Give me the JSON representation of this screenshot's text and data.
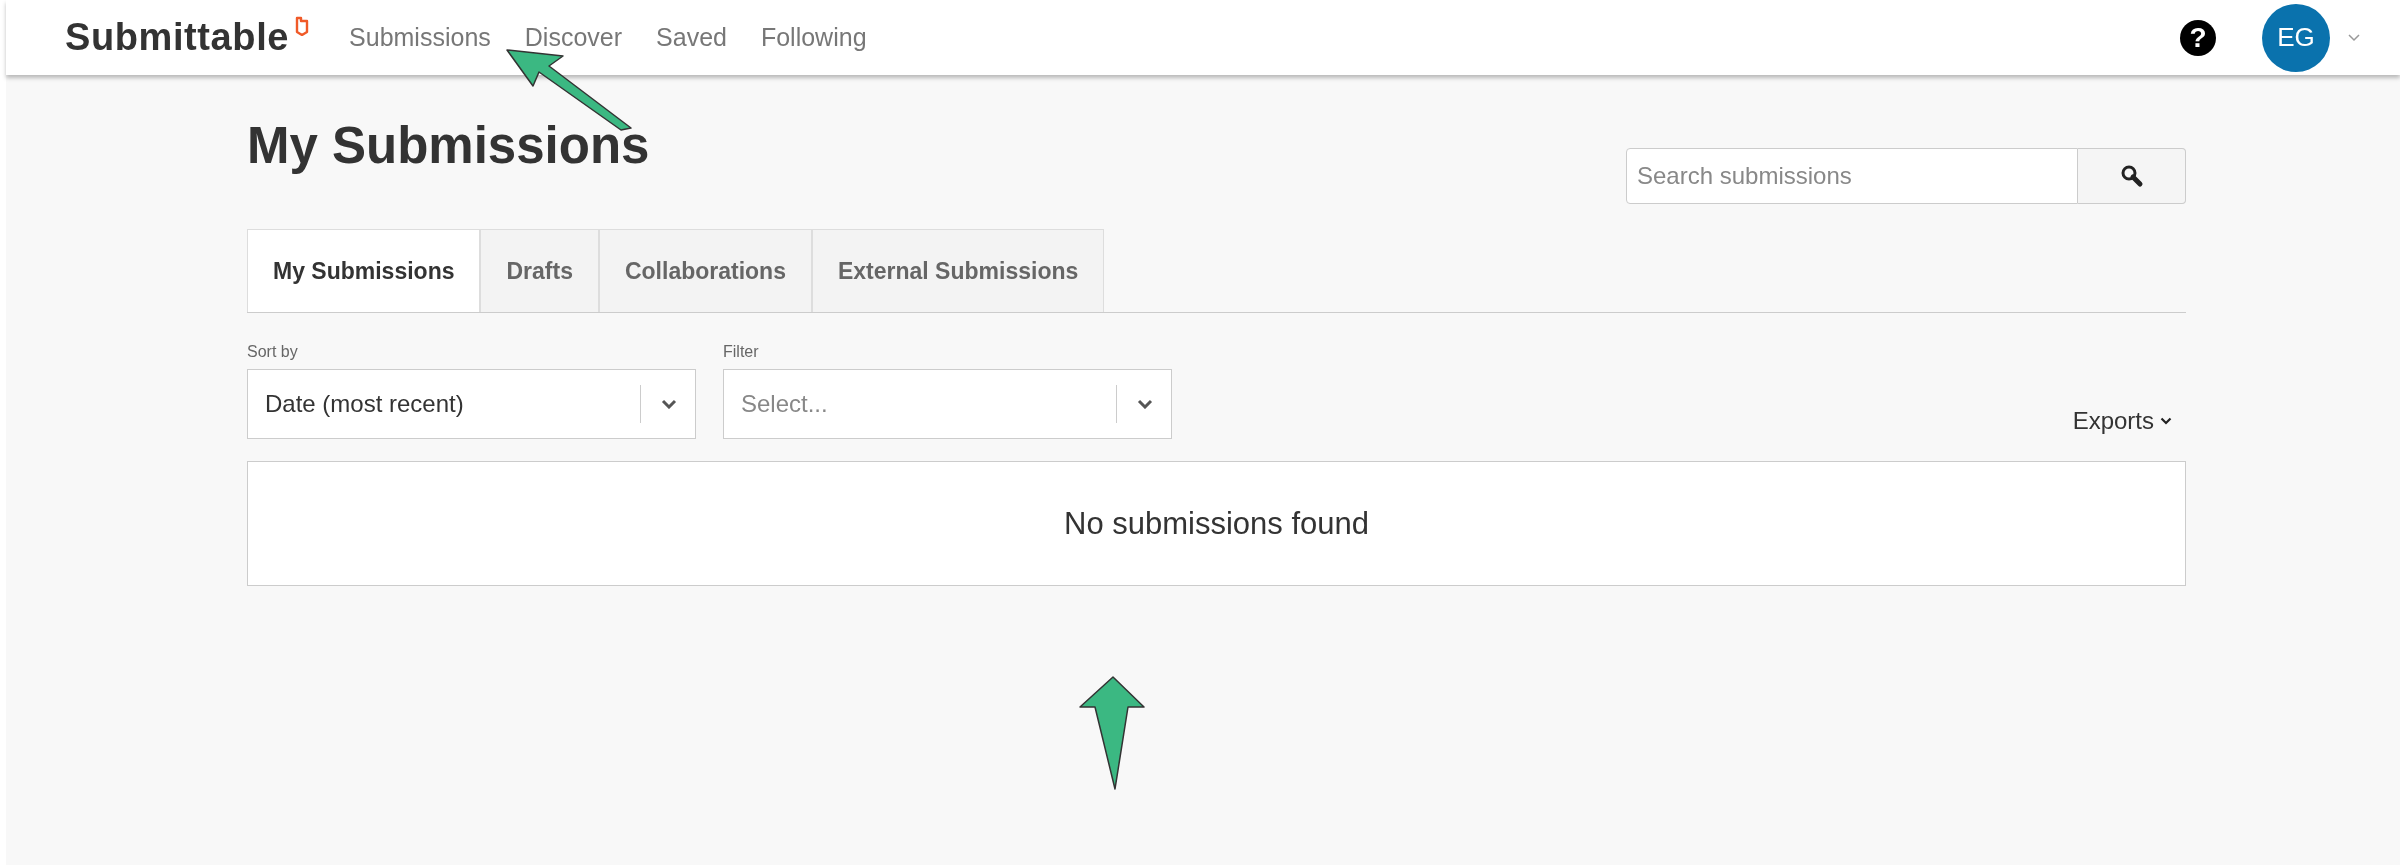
{
  "header": {
    "logo": "Submittable",
    "nav": [
      {
        "label": "Submissions"
      },
      {
        "label": "Discover"
      },
      {
        "label": "Saved"
      },
      {
        "label": "Following"
      }
    ],
    "help": "?",
    "avatar": "EG"
  },
  "page": {
    "title": "My Submissions",
    "search": {
      "placeholder": "Search submissions"
    },
    "tabs": [
      {
        "label": "My Submissions",
        "selected": true
      },
      {
        "label": "Drafts",
        "selected": false
      },
      {
        "label": "Collaborations",
        "selected": false
      },
      {
        "label": "External Submissions",
        "selected": false
      }
    ],
    "sort": {
      "label": "Sort by",
      "value": "Date (most recent)"
    },
    "filter": {
      "label": "Filter",
      "placeholder": "Select..."
    },
    "exports": "Exports",
    "empty_message": "No submissions found"
  }
}
